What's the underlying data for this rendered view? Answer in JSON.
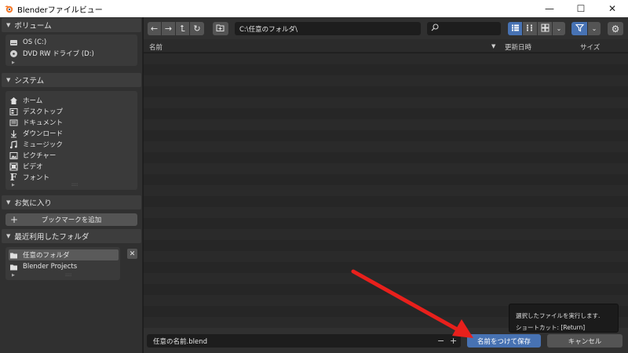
{
  "window": {
    "title": "Blenderファイルビュー",
    "minimize": "—",
    "maximize": "☐",
    "close": "✕"
  },
  "sidebar": {
    "volumes": {
      "header": "ボリューム",
      "items": [
        {
          "label": "OS (C:)",
          "icon": "drive-icon"
        },
        {
          "label": "DVD RW ドライブ (D:)",
          "icon": "disc-icon"
        }
      ]
    },
    "system": {
      "header": "システム",
      "items": [
        {
          "label": "ホーム",
          "icon": "home-icon"
        },
        {
          "label": "デスクトップ",
          "icon": "desktop-icon"
        },
        {
          "label": "ドキュメント",
          "icon": "document-icon"
        },
        {
          "label": "ダウンロード",
          "icon": "download-icon"
        },
        {
          "label": "ミュージック",
          "icon": "music-icon"
        },
        {
          "label": "ピクチャー",
          "icon": "picture-icon"
        },
        {
          "label": "ビデオ",
          "icon": "video-icon"
        },
        {
          "label": "フォント",
          "icon": "font-icon"
        }
      ]
    },
    "favorites": {
      "header": "お気に入り",
      "add_bookmark": "ブックマークを追加"
    },
    "recent": {
      "header": "最近利用したフォルダ",
      "items": [
        {
          "label": "任意のフォルダ",
          "selected": true
        },
        {
          "label": "Blender Projects",
          "selected": false
        }
      ]
    }
  },
  "toolbar": {
    "path": "C:\\任意のフォルダ\\",
    "search_placeholder": ""
  },
  "columns": {
    "name": "名前",
    "modified": "更新日時",
    "size": "サイズ"
  },
  "bottom": {
    "filename": "任意の名前.blend",
    "save_label": "名前をつけて保存",
    "cancel_label": "キャンセル"
  },
  "tooltip": {
    "line1": "選択したファイルを実行します.",
    "line2": "ショートカット: [Return]"
  },
  "colors": {
    "accent": "#4772b3",
    "annotation_arrow": "#e8201c"
  }
}
